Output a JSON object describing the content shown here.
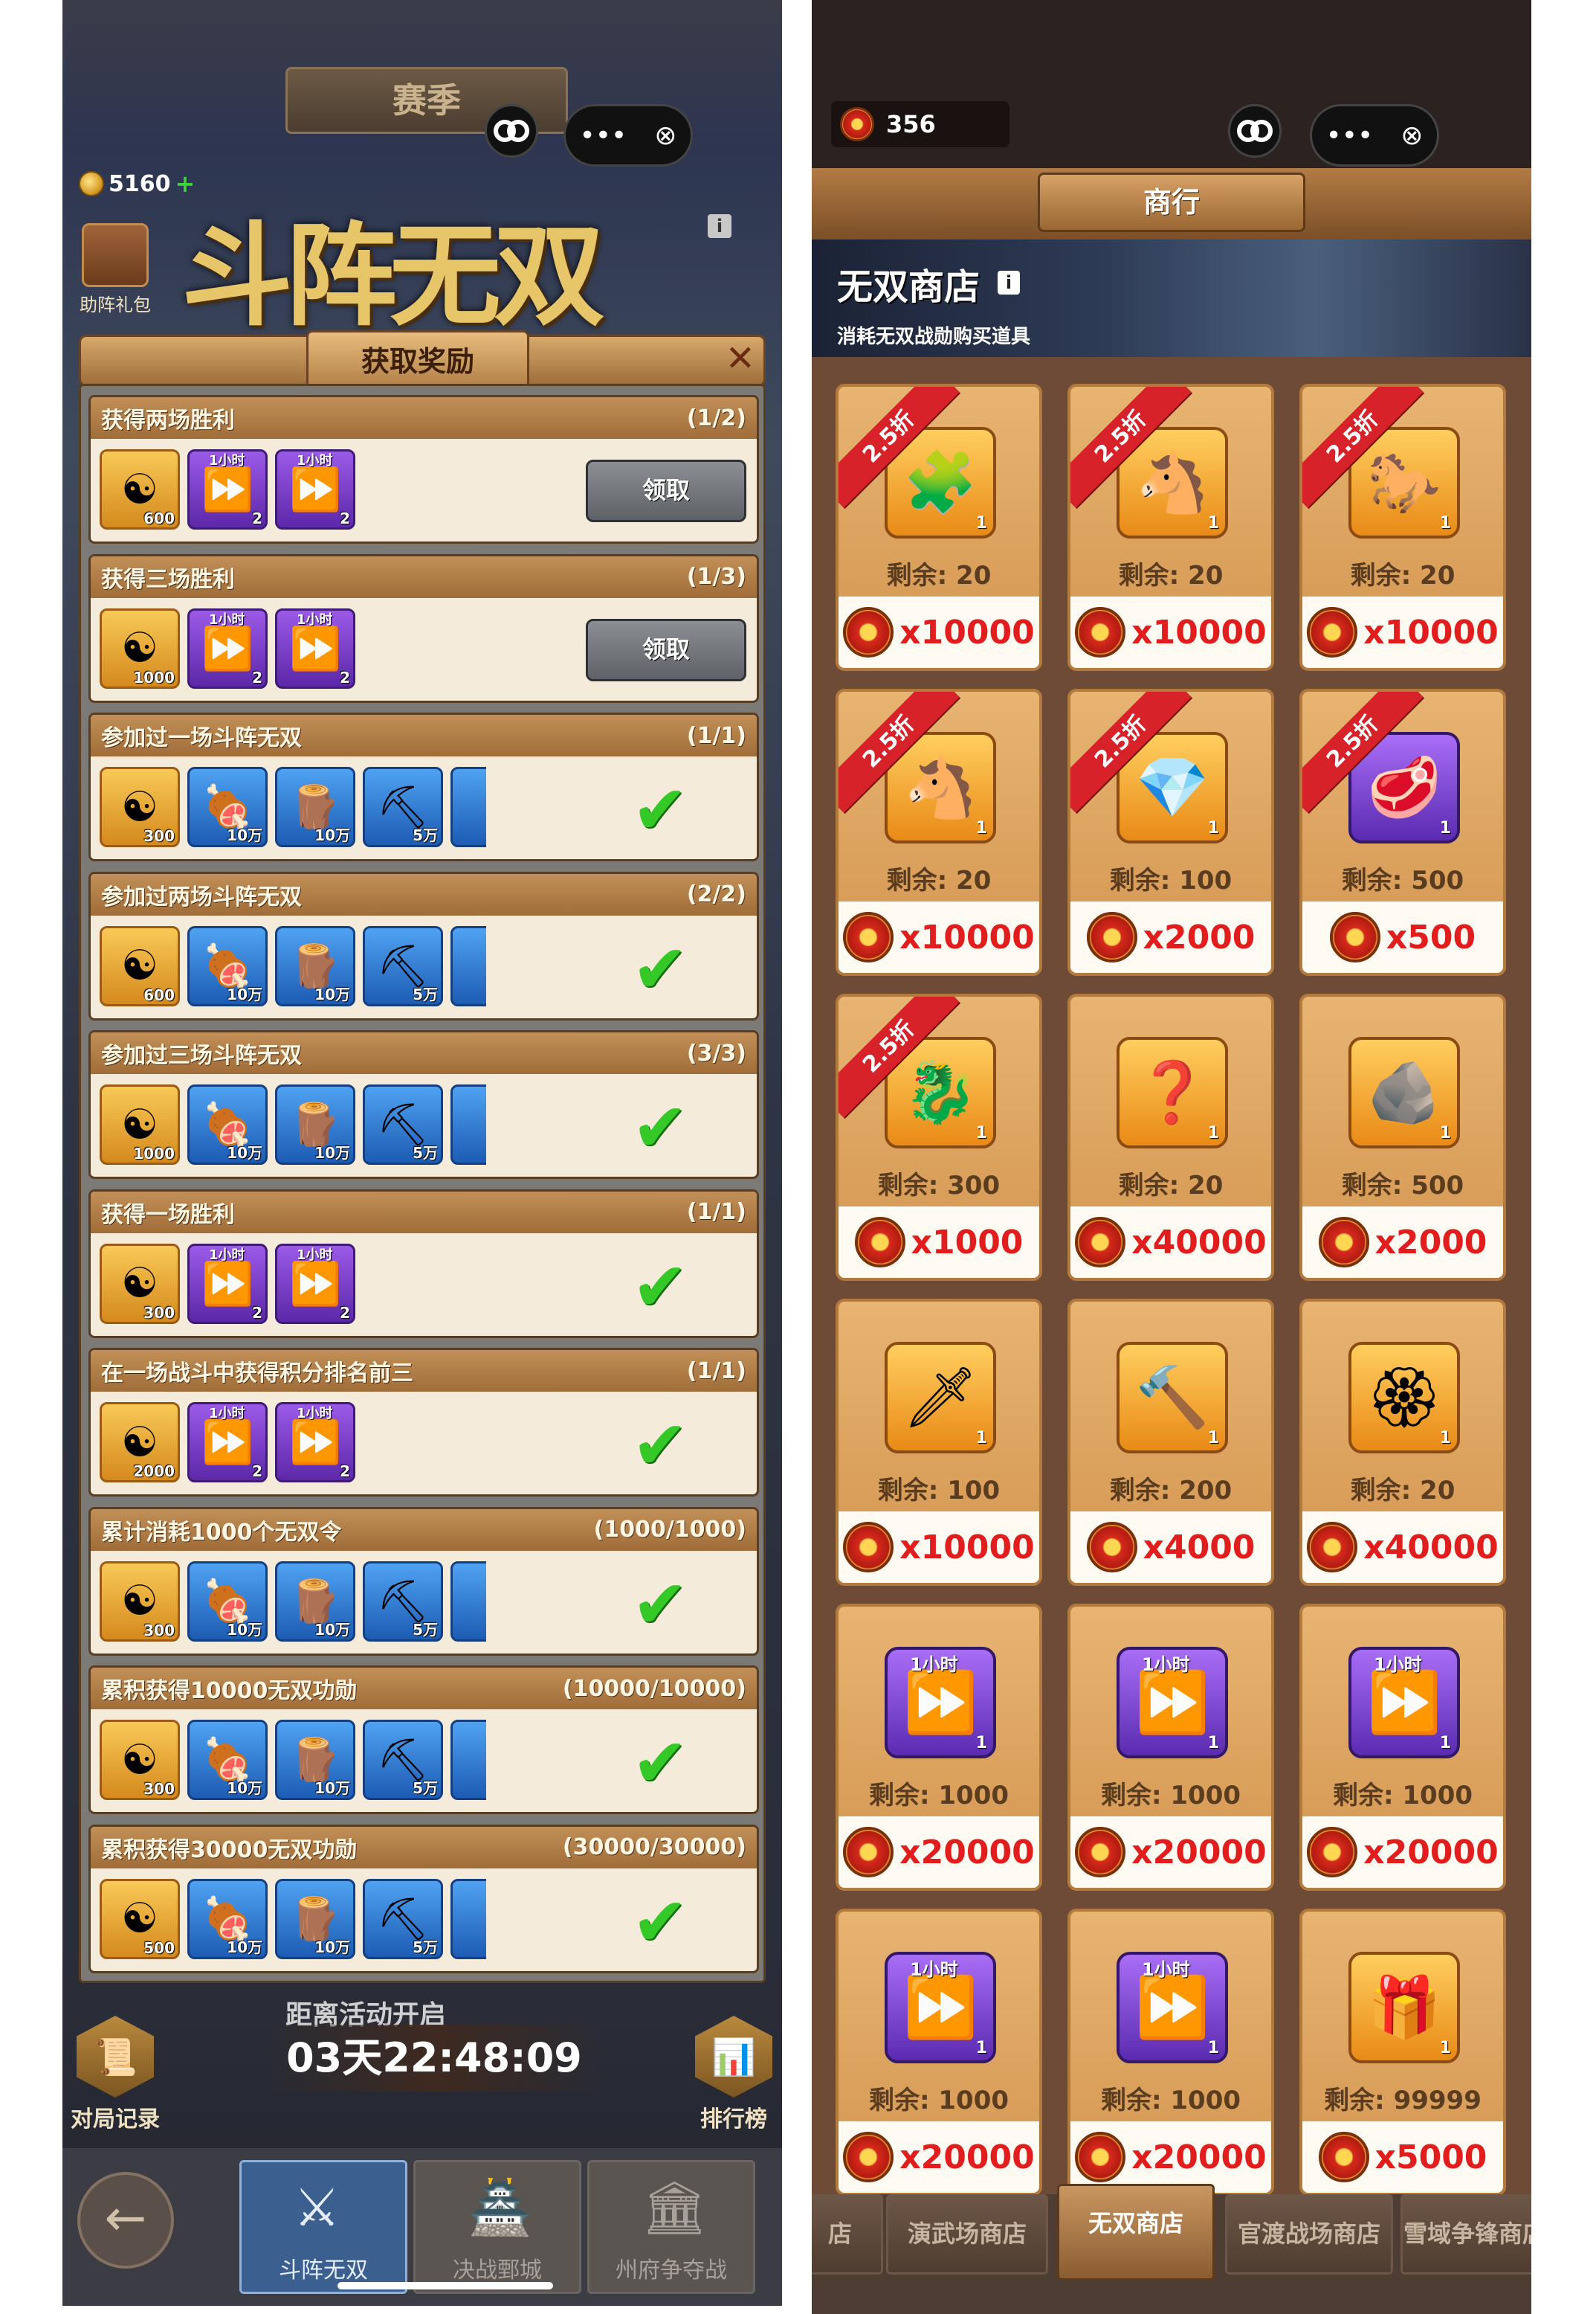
{
  "left": {
    "season_label": "赛季",
    "capsule_menu": "•••",
    "capsule_close": "⊗",
    "coins": "5160",
    "coins_plus": "+",
    "gift_label": "助阵礼包",
    "logo_text": "斗阵无双",
    "dialog": {
      "title": "获取奖励",
      "close": "✕",
      "claim_label": "领取",
      "cards": [
        {
          "title": "获得两场胜利",
          "progress": "(1/2)",
          "status": "claim",
          "items": [
            {
              "type": "gold",
              "qty": "600"
            },
            {
              "type": "speed",
              "time": "1小时",
              "qty": "2"
            },
            {
              "type": "speed-gem",
              "time": "1小时",
              "qty": "2"
            }
          ]
        },
        {
          "title": "获得三场胜利",
          "progress": "(1/3)",
          "status": "claim",
          "items": [
            {
              "type": "gold",
              "qty": "1000"
            },
            {
              "type": "speed",
              "time": "1小时",
              "qty": "2"
            },
            {
              "type": "speed-gem",
              "time": "1小时",
              "qty": "2"
            }
          ]
        },
        {
          "title": "参加过一场斗阵无双",
          "progress": "(1/1)",
          "status": "done",
          "items": [
            {
              "type": "gold",
              "qty": "300"
            },
            {
              "type": "meat",
              "qty": "10万"
            },
            {
              "type": "wood",
              "qty": "10万"
            },
            {
              "type": "ore",
              "qty": "5万"
            }
          ]
        },
        {
          "title": "参加过两场斗阵无双",
          "progress": "(2/2)",
          "status": "done",
          "items": [
            {
              "type": "gold",
              "qty": "600"
            },
            {
              "type": "meat",
              "qty": "10万"
            },
            {
              "type": "wood",
              "qty": "10万"
            },
            {
              "type": "ore",
              "qty": "5万"
            }
          ]
        },
        {
          "title": "参加过三场斗阵无双",
          "progress": "(3/3)",
          "status": "done",
          "items": [
            {
              "type": "gold",
              "qty": "1000"
            },
            {
              "type": "meat",
              "qty": "10万"
            },
            {
              "type": "wood",
              "qty": "10万"
            },
            {
              "type": "ore",
              "qty": "5万"
            }
          ]
        },
        {
          "title": "获得一场胜利",
          "progress": "(1/1)",
          "status": "done",
          "items": [
            {
              "type": "gold",
              "qty": "300"
            },
            {
              "type": "speed",
              "time": "1小时",
              "qty": "2"
            },
            {
              "type": "speed-gem",
              "time": "1小时",
              "qty": "2"
            }
          ]
        },
        {
          "title": "在一场战斗中获得积分排名前三",
          "progress": "(1/1)",
          "status": "done",
          "items": [
            {
              "type": "gold",
              "qty": "2000"
            },
            {
              "type": "speed",
              "time": "1小时",
              "qty": "2"
            },
            {
              "type": "speed-gem",
              "time": "1小时",
              "qty": "2"
            }
          ]
        },
        {
          "title": "累计消耗1000个无双令",
          "progress": "(1000/1000)",
          "status": "done",
          "items": [
            {
              "type": "gold",
              "qty": "300"
            },
            {
              "type": "meat",
              "qty": "10万"
            },
            {
              "type": "wood",
              "qty": "10万"
            },
            {
              "type": "ore",
              "qty": "5万"
            }
          ]
        },
        {
          "title": "累积获得10000无双功勋",
          "progress": "(10000/10000)",
          "status": "done",
          "items": [
            {
              "type": "gold",
              "qty": "300"
            },
            {
              "type": "meat",
              "qty": "10万"
            },
            {
              "type": "wood",
              "qty": "10万"
            },
            {
              "type": "ore",
              "qty": "5万"
            }
          ]
        },
        {
          "title": "累积获得30000无双功勋",
          "progress": "(30000/30000)",
          "status": "done",
          "items": [
            {
              "type": "gold",
              "qty": "500"
            },
            {
              "type": "meat",
              "qty": "10万"
            },
            {
              "type": "wood",
              "qty": "10万"
            },
            {
              "type": "ore",
              "qty": "5万"
            }
          ]
        }
      ]
    },
    "countdown_label": "距离活动开启",
    "countdown": "03天22:48:09",
    "battle_log_label": "对局记录",
    "ranking_label": "排行榜",
    "tabs": [
      "斗阵无双",
      "决战鄄城",
      "州府争夺战"
    ],
    "active_tab": 0
  },
  "right": {
    "currency": "356",
    "capsule_menu": "•••",
    "capsule_close": "⊗",
    "header_title": "商行",
    "hero_title": "无双商店",
    "hero_info": "i",
    "hero_subtitle": "消耗无双战勋购买道具",
    "discount_label": "2.5折",
    "remain_prefix": "剩余: ",
    "items": [
      {
        "icon": "red-puzzle",
        "glyph": "🧩",
        "qty": "1",
        "remain": "20",
        "price": "x10000",
        "discount": true
      },
      {
        "icon": "white-horse-puzzle",
        "glyph": "🐴",
        "qty": "1",
        "remain": "20",
        "price": "x10000",
        "discount": true
      },
      {
        "icon": "brown-horse-puzzle",
        "glyph": "🐎",
        "qty": "1",
        "remain": "20",
        "price": "x10000",
        "discount": true
      },
      {
        "icon": "black-horse-puzzle",
        "glyph": "🐴",
        "qty": "1",
        "remain": "20",
        "price": "x10000",
        "discount": true
      },
      {
        "icon": "jade-tablet",
        "glyph": "💎",
        "qty": "1",
        "remain": "100",
        "price": "x2000",
        "discount": true
      },
      {
        "icon": "leather",
        "glyph": "🥩",
        "qty": "1",
        "remain": "500",
        "price": "x500",
        "discount": true,
        "purple": true
      },
      {
        "icon": "dragon-seal",
        "glyph": "🐉",
        "qty": "1",
        "remain": "300",
        "price": "x1000",
        "discount": true
      },
      {
        "icon": "mystery-chest",
        "glyph": "❓",
        "qty": "1",
        "remain": "20",
        "price": "x40000",
        "discount": false
      },
      {
        "icon": "green-stone",
        "glyph": "🪨",
        "qty": "1",
        "remain": "500",
        "price": "x2000",
        "discount": false
      },
      {
        "icon": "dagger",
        "glyph": "🗡",
        "qty": "1",
        "remain": "100",
        "price": "x10000",
        "discount": false
      },
      {
        "icon": "hammer-gem",
        "glyph": "🔨",
        "qty": "1",
        "remain": "200",
        "price": "x4000",
        "discount": false
      },
      {
        "icon": "red-medal",
        "glyph": "🏵",
        "qty": "1",
        "remain": "20",
        "price": "x40000",
        "discount": false
      },
      {
        "icon": "speedup",
        "glyph": "⏩",
        "time": "1小时",
        "qty": "1",
        "remain": "1000",
        "price": "x20000",
        "discount": false,
        "purple": true
      },
      {
        "icon": "speedup-hammer",
        "glyph": "⏩",
        "time": "1小时",
        "qty": "1",
        "remain": "1000",
        "price": "x20000",
        "discount": false,
        "purple": true
      },
      {
        "icon": "speedup-soldier",
        "glyph": "⏩",
        "time": "1小时",
        "qty": "1",
        "remain": "1000",
        "price": "x20000",
        "discount": false,
        "purple": true
      },
      {
        "icon": "speedup-pot",
        "glyph": "⏩",
        "time": "1小时",
        "qty": "1",
        "remain": "1000",
        "price": "x20000",
        "discount": false,
        "purple": true
      },
      {
        "icon": "speedup-gem",
        "glyph": "⏩",
        "time": "1小时",
        "qty": "1",
        "remain": "1000",
        "price": "x20000",
        "discount": false,
        "purple": true
      },
      {
        "icon": "treasure-chest",
        "glyph": "🎁",
        "qty": "1",
        "remain": "99999",
        "price": "x5000",
        "discount": false
      }
    ],
    "tabs": [
      "店",
      "演武场商店",
      "无双商店",
      "官渡战场商店",
      "雪域争锋商店"
    ],
    "active_tab": 2,
    "colors": {
      "price_red": "#e21d1d",
      "discount_red": "#d8222a",
      "tile_gold": "#e8b472",
      "active_tab_blue": "#3b5f8f"
    }
  }
}
